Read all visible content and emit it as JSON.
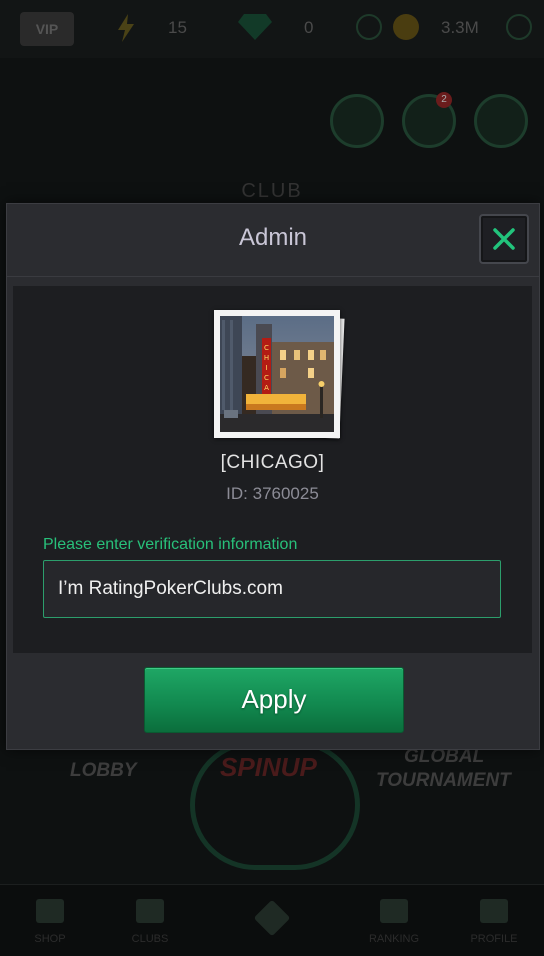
{
  "background": {
    "vip_label": "VIP",
    "energy_count": "15",
    "gems_count": "0",
    "coins_amount": "3.3M",
    "club_title": "CLUB",
    "mail_badge": "2",
    "menu": {
      "lobby": "LOBBY",
      "spinup": "SPINUP",
      "global_tournament_1": "GLOBAL",
      "global_tournament_2": "TOURNAMENT"
    },
    "tabs": [
      "SHOP",
      "CLUBS",
      "",
      "RANKING",
      "PROFILE"
    ]
  },
  "modal": {
    "title": "Admin",
    "club_name": "[CHICAGO]",
    "club_id": "ID: 3760025",
    "verify_label": "Please enter verification information",
    "verify_value": "I’m RatingPokerClubs.com",
    "apply_label": "Apply"
  },
  "colors": {
    "accent_green": "#28c07a",
    "button_green": "#128a50",
    "modal_bg": "#2b2c30"
  }
}
